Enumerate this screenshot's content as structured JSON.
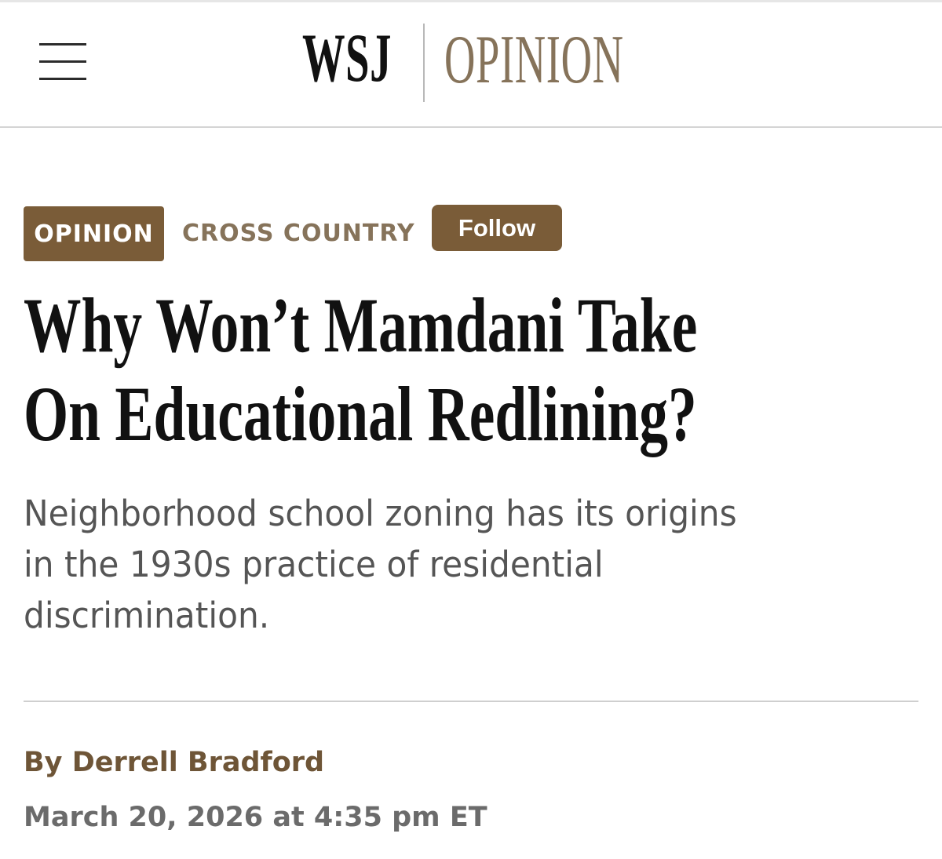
{
  "header": {
    "menu_icon": "hamburger-menu-icon",
    "logo_primary": "WSJ",
    "logo_section": "OPINION"
  },
  "article": {
    "section_badge": "OPINION",
    "column_name": "CROSS COUNTRY",
    "follow_label": "Follow",
    "headline_line1": "Why Won’t Mamdani Take",
    "headline_line2": "On Educational Redlining?",
    "dek_line1": "Neighborhood school zoning has its origins",
    "dek_line2": "in the 1930s practice of residential",
    "dek_line3": "discrimination.",
    "byline_prefix": "By ",
    "author": "Derrell Bradford",
    "timestamp": "March 20, 2026 at 4:35 pm ET"
  },
  "colors": {
    "brand_brown": "#7a5c38",
    "opinion_tan": "#86735a",
    "headline": "#111111",
    "dek_gray": "#555555"
  }
}
